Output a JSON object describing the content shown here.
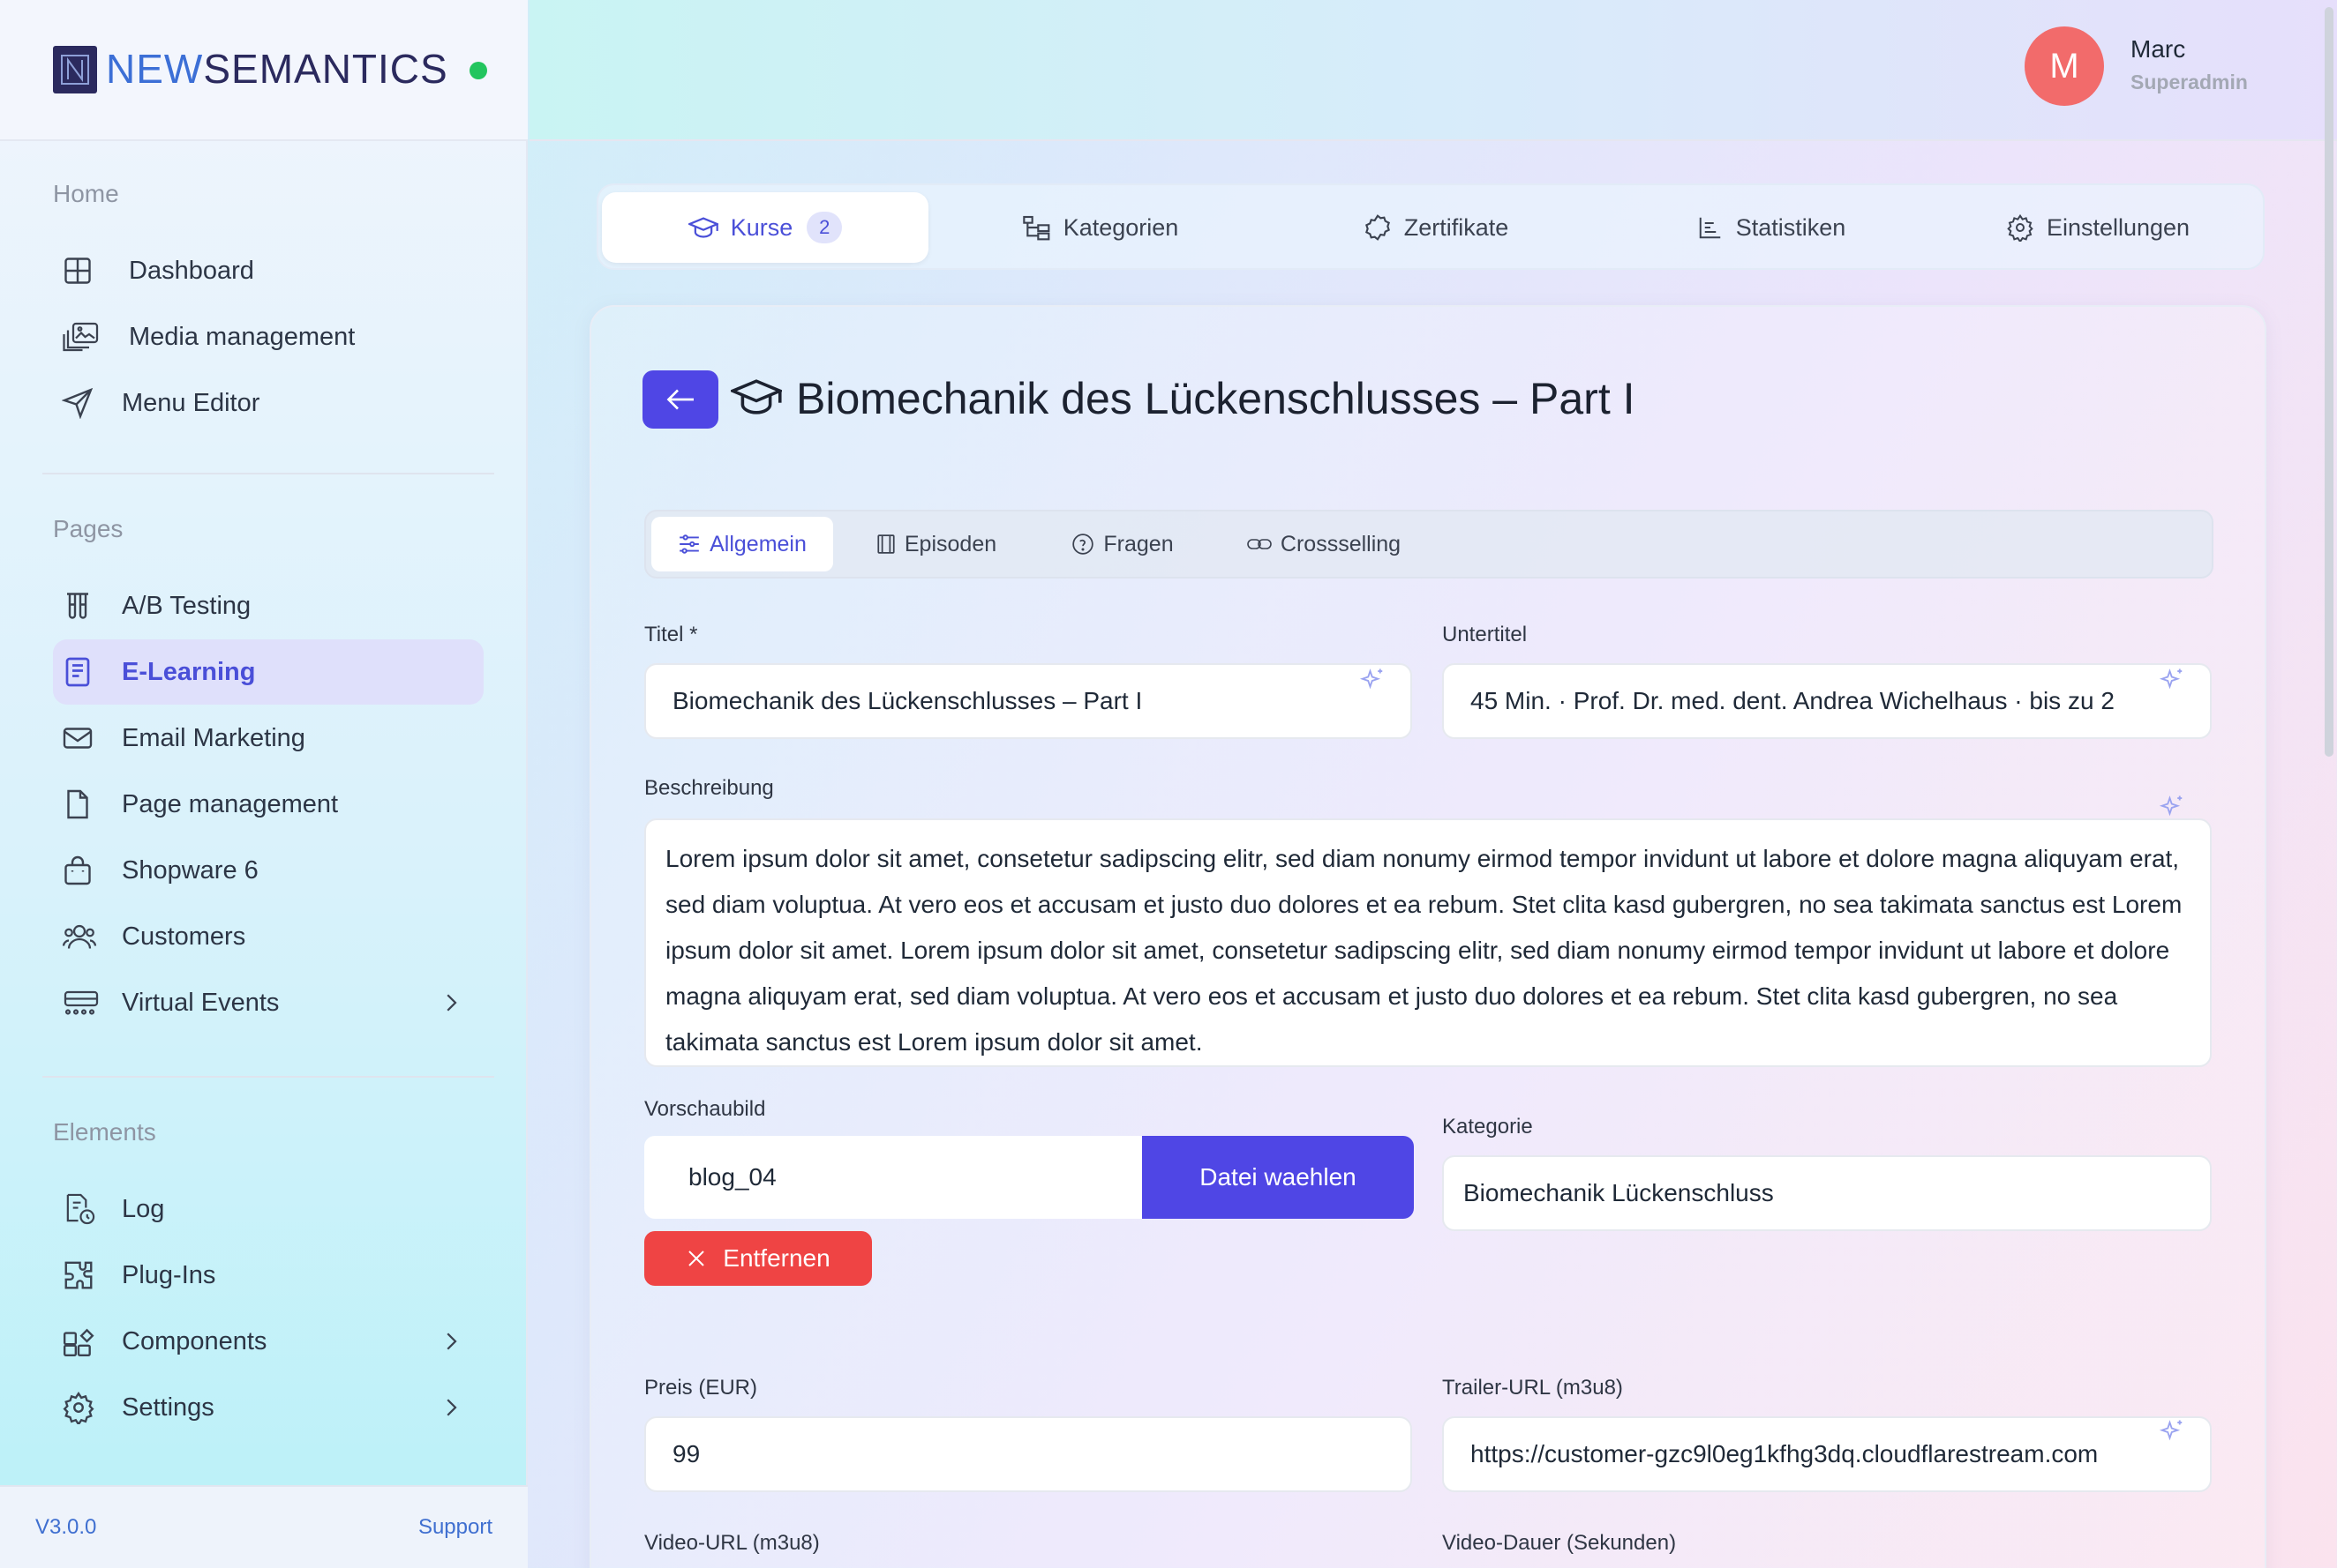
{
  "brand": {
    "part1": "NEW",
    "part2": "SEMANTICS",
    "status_color": "#22c55e"
  },
  "user": {
    "initial": "M",
    "name": "Marc",
    "role": "Superadmin",
    "avatar_color": "#f26b6b"
  },
  "sidebar": {
    "sections": [
      {
        "title": "Home",
        "items": [
          {
            "label": "Dashboard",
            "icon": "grid-icon"
          },
          {
            "label": "Media management",
            "icon": "images-icon"
          },
          {
            "label": "Menu Editor",
            "icon": "send-icon"
          }
        ]
      },
      {
        "title": "Pages",
        "items": [
          {
            "label": "A/B Testing",
            "icon": "test-tubes-icon"
          },
          {
            "label": "E-Learning",
            "icon": "book-icon",
            "active": true
          },
          {
            "label": "Email Marketing",
            "icon": "mail-icon"
          },
          {
            "label": "Page management",
            "icon": "file-icon"
          },
          {
            "label": "Shopware 6",
            "icon": "shopping-bag-icon"
          },
          {
            "label": "Customers",
            "icon": "users-icon"
          },
          {
            "label": "Virtual Events",
            "icon": "events-icon",
            "has_children": true
          }
        ]
      },
      {
        "title": "Elements",
        "items": [
          {
            "label": "Log",
            "icon": "log-icon"
          },
          {
            "label": "Plug-Ins",
            "icon": "puzzle-icon"
          },
          {
            "label": "Components",
            "icon": "components-icon",
            "has_children": true
          },
          {
            "label": "Settings",
            "icon": "gear-icon",
            "has_children": true
          }
        ]
      }
    ],
    "version": "V3.0.0",
    "support": "Support"
  },
  "tabs": [
    {
      "label": "Kurse",
      "badge": "2",
      "active": true
    },
    {
      "label": "Kategorien"
    },
    {
      "label": "Zertifikate"
    },
    {
      "label": "Statistiken"
    },
    {
      "label": "Einstellungen"
    }
  ],
  "course": {
    "title": "Biomechanik des Lückenschlusses – Part I"
  },
  "subtabs": [
    {
      "label": "Allgemein",
      "active": true
    },
    {
      "label": "Episoden"
    },
    {
      "label": "Fragen"
    },
    {
      "label": "Crossselling"
    }
  ],
  "form": {
    "titel_label": "Titel *",
    "titel_value": "Biomechanik des Lückenschlusses – Part I",
    "untertitel_label": "Untertitel",
    "untertitel_value": "45 Min. · Prof. Dr. med. dent. Andrea Wichelhaus · bis zu 2",
    "beschreibung_label": "Beschreibung",
    "beschreibung_value": "Lorem ipsum dolor sit amet, consetetur sadipscing elitr, sed diam nonumy eirmod tempor invidunt ut labore et dolore magna aliquyam erat, sed diam voluptua. At vero eos et accusam et justo duo dolores et ea rebum. Stet clita kasd gubergren, no sea takimata sanctus est Lorem ipsum dolor sit amet. Lorem ipsum dolor sit amet, consetetur sadipscing elitr, sed diam nonumy eirmod tempor invidunt ut labore et dolore magna aliquyam erat, sed diam voluptua. At vero eos et accusam et justo duo dolores et ea rebum. Stet clita kasd gubergren, no sea takimata sanctus est Lorem ipsum dolor sit amet.",
    "vorschaubild_label": "Vorschaubild",
    "vorschaubild_value": "blog_04",
    "datei_button": "Datei waehlen",
    "entfernen_button": "Entfernen",
    "kategorie_label": "Kategorie",
    "kategorie_value": "Biomechanik Lückenschluss",
    "preis_label": "Preis (EUR)",
    "preis_value": "99",
    "trailer_label": "Trailer-URL (m3u8)",
    "trailer_value": "https://customer-gzc9l0eg1kfhg3dq.cloudflarestream.com",
    "video_url_label": "Video-URL (m3u8)",
    "video_dauer_label": "Video-Dauer (Sekunden)"
  },
  "colors": {
    "accent": "#4f46e5",
    "danger": "#ef4444"
  }
}
